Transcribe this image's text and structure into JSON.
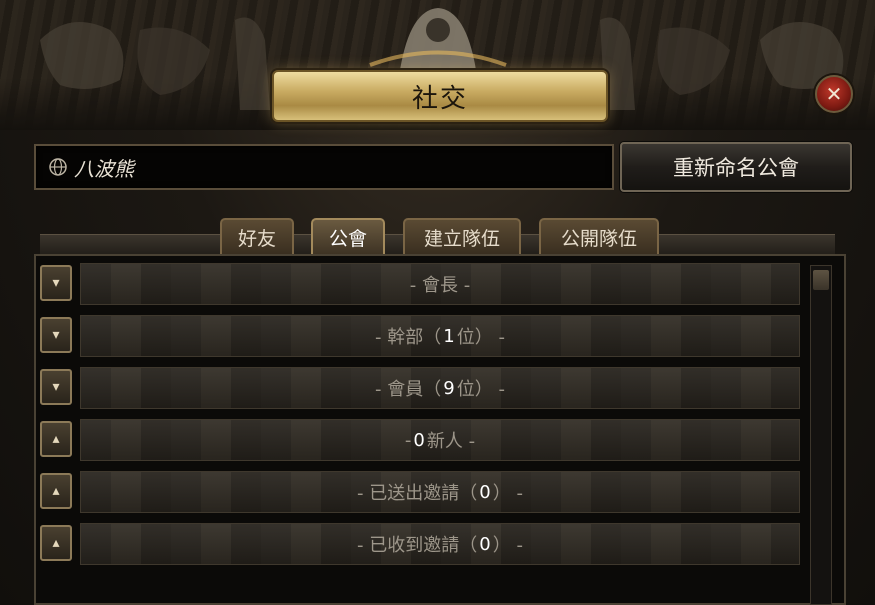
{
  "window": {
    "title": "社交",
    "close_icon": "close-icon"
  },
  "guild": {
    "name": "八波熊",
    "rename_label": "重新命名公會"
  },
  "tabs": [
    {
      "label": "好友",
      "active": false
    },
    {
      "label": "公會",
      "active": true
    },
    {
      "label": "建立隊伍",
      "active": false
    },
    {
      "label": "公開隊伍",
      "active": false
    }
  ],
  "groups": [
    {
      "prefix": "- 會長 -",
      "count": null,
      "suffix": "",
      "expanded": true
    },
    {
      "prefix": "- 幹部（",
      "count": "1",
      "suffix": "位） -",
      "expanded": true
    },
    {
      "prefix": "- 會員（",
      "count": "9",
      "suffix": "位） -",
      "expanded": true
    },
    {
      "prefix": "- ",
      "count": "0",
      "suffix": "新人 -",
      "expanded": false
    },
    {
      "prefix": "- 已送出邀請（",
      "count": "0",
      "suffix": "） -",
      "expanded": false
    },
    {
      "prefix": "- 已收到邀請（",
      "count": "0",
      "suffix": "） -",
      "expanded": false
    }
  ],
  "colors": {
    "accent": "#c9ab62",
    "close": "#a0281c"
  }
}
